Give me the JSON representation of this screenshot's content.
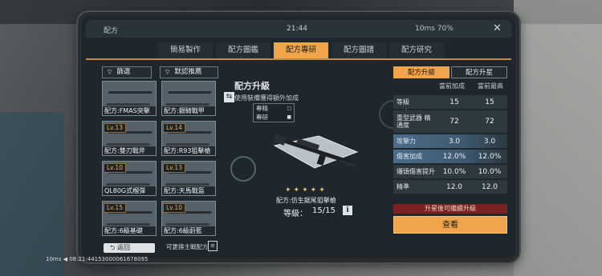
{
  "window": {
    "title": "配方",
    "clock": "21:44",
    "network": "10ms 70%",
    "close_icon": "close-icon"
  },
  "tabs": [
    {
      "label": "簡易製作",
      "active": false
    },
    {
      "label": "配方圖鑑",
      "active": false
    },
    {
      "label": "配方專研",
      "active": true
    },
    {
      "label": "配方圖譜",
      "active": false
    },
    {
      "label": "配方研究",
      "active": false
    }
  ],
  "filters": {
    "filter_label": "篩選",
    "sort_label": "默認推薦"
  },
  "cards": [
    {
      "level": "",
      "name": "配方:FMAS突擊"
    },
    {
      "level": "",
      "name": "配方:銀騎戰甲"
    },
    {
      "level": "Lv.13",
      "name": "配方:雙刃戰斧"
    },
    {
      "level": "Lv.14",
      "name": "配方:R93狙擊槍"
    },
    {
      "level": "Lv.10",
      "name": "QL80G式榴彈"
    },
    {
      "level": "Lv.13",
      "name": "配方:天馬戰盔"
    },
    {
      "level": "Lv.15",
      "name": "配方:6級基礎"
    },
    {
      "level": "Lv.10",
      "name": "配方:6級蔚藍"
    }
  ],
  "grid_note": "可更換主戰配方",
  "center": {
    "title": "配方升級",
    "subtitle": "使用裝備獲得額外加成",
    "slots": [
      {
        "label": "專精"
      },
      {
        "label": "專研"
      }
    ],
    "weapon_name": "配方:仿生鋸尾狙擊槍",
    "level_label": "等級：",
    "level_value": "15/15",
    "star_count": 5
  },
  "panel": {
    "tab_upgrade": "配方升級",
    "tab_star": "配方升星",
    "col_current": "當前加成",
    "col_max": "當前最高",
    "stats": [
      {
        "label": "等級",
        "current": "15",
        "max": "15"
      },
      {
        "label": "重型武器 精通度",
        "current": "72",
        "max": "72"
      },
      {
        "label": "攻擊力",
        "current": "3.0",
        "max": "3.0"
      },
      {
        "label": "傷害加成",
        "current": "12.0%",
        "max": "12.0%"
      },
      {
        "label": "爆頭傷害提升",
        "current": "10.0%",
        "max": "10.0%"
      },
      {
        "label": "精準",
        "current": "12.0",
        "max": "12.0"
      }
    ],
    "upgrade_note": "升星後可繼續升級",
    "view_button": "查看"
  },
  "back_label": "返回",
  "bottom_status": "10ms ◀ 08:21:44153000061678095",
  "colors": {
    "accent": "#f0a54a",
    "warning": "#7a2121"
  }
}
